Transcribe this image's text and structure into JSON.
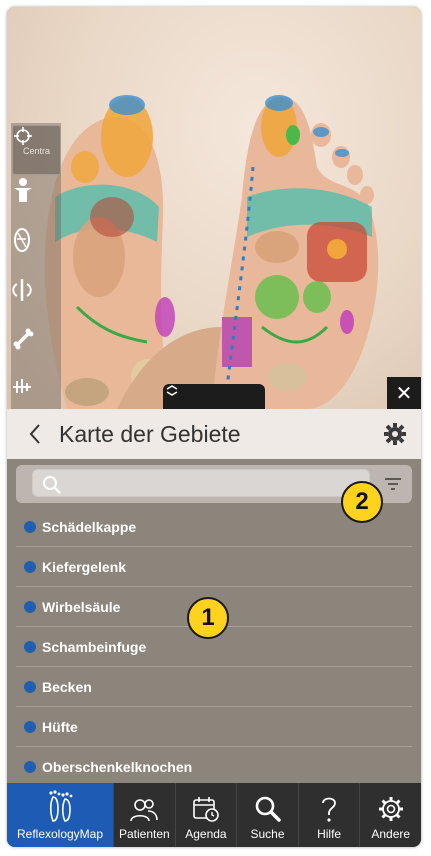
{
  "viewer": {
    "tools": [
      {
        "icon": "crosshair-icon",
        "label": "Centra"
      },
      {
        "icon": "body-icon",
        "label": ""
      },
      {
        "icon": "muscle-icon",
        "label": ""
      },
      {
        "icon": "nerve-icon",
        "label": ""
      },
      {
        "icon": "bone-icon",
        "label": ""
      },
      {
        "icon": "skeleton-icon",
        "label": ""
      }
    ],
    "close_label": "✕"
  },
  "panel": {
    "title": "Karte der Gebiete",
    "search": {
      "value": "",
      "placeholder": ""
    },
    "items": [
      {
        "label": "Schädelkappe",
        "color": "#1f5fb0"
      },
      {
        "label": "Kiefergelenk",
        "color": "#1f5fb0"
      },
      {
        "label": "Wirbelsäule",
        "color": "#1f5fb0"
      },
      {
        "label": "Schambeinfuge",
        "color": "#1f5fb0"
      },
      {
        "label": "Becken",
        "color": "#1f5fb0"
      },
      {
        "label": "Hüfte",
        "color": "#1f5fb0"
      },
      {
        "label": "Oberschenkelknochen",
        "color": "#1f5fb0"
      }
    ],
    "callouts": [
      "1",
      "2"
    ]
  },
  "tabbar": {
    "tabs": [
      {
        "label": "ReflexologyMap",
        "icon": "feet-icon",
        "active": true
      },
      {
        "label": "Patienten",
        "icon": "people-icon",
        "active": false
      },
      {
        "label": "Agenda",
        "icon": "calendar-icon",
        "active": false
      },
      {
        "label": "Suche",
        "icon": "search-icon",
        "active": false
      },
      {
        "label": "Hilfe",
        "icon": "question-icon",
        "active": false
      },
      {
        "label": "Andere",
        "icon": "gear-icon",
        "active": false
      }
    ],
    "active_color": "#1d5bb5"
  }
}
